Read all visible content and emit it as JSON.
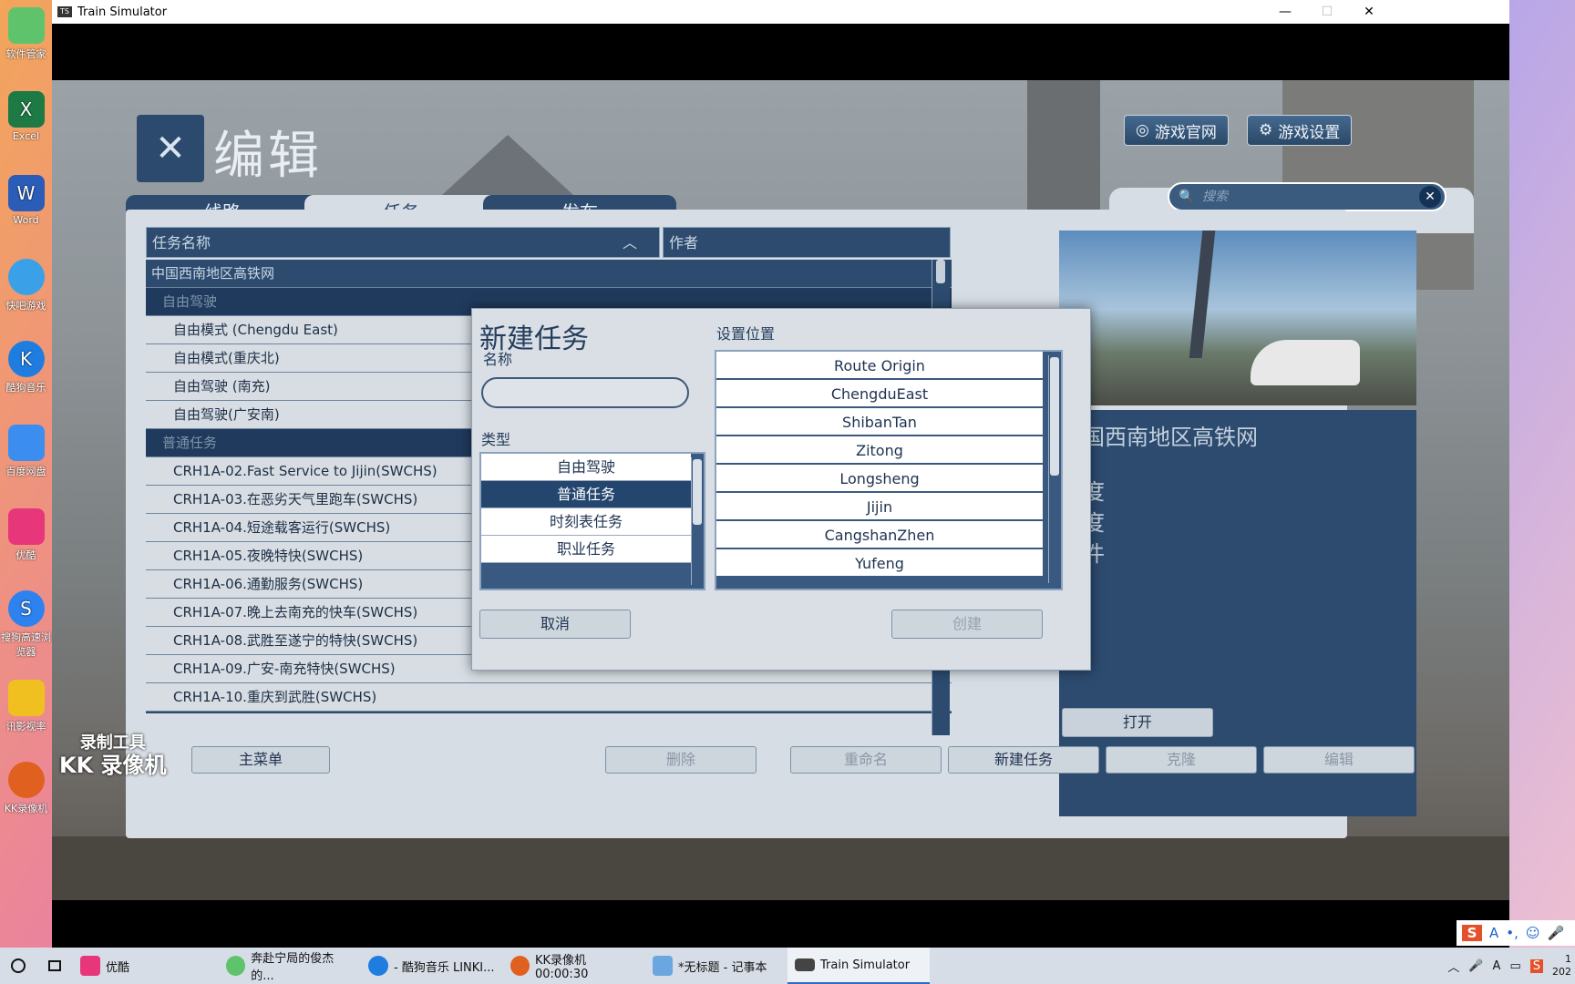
{
  "desktop": {
    "icons": [
      {
        "label": "软件管家",
        "color": "#5ec36b"
      },
      {
        "label": "Excel",
        "color": "#1d7a45",
        "glyph": "X"
      },
      {
        "label": "Word",
        "color": "#2b5db8",
        "glyph": "W"
      },
      {
        "label": "快吧游戏",
        "color": "#3aa0e8"
      },
      {
        "label": "酷狗音乐",
        "color": "#1f7de0",
        "glyph": "K"
      },
      {
        "label": "百度网盘",
        "color": "#3b8ef0"
      },
      {
        "label": "优酷",
        "color": "#e8367a"
      },
      {
        "label": "搜狗高速浏览器",
        "color": "#2e82f0",
        "glyph": "S"
      },
      {
        "label": "讯影视率",
        "color": "#f0c020"
      },
      {
        "label": "KK录像机",
        "color": "#e06020"
      }
    ]
  },
  "window": {
    "title": "Train Simulator",
    "icon_text": "TS",
    "controls": {
      "minimize": "—",
      "maximize": "☐",
      "close": "✕"
    }
  },
  "app": {
    "page_title": "编辑",
    "logo_icon": "tools-icon",
    "top_buttons": {
      "website": "游戏官网",
      "settings": "游戏设置"
    },
    "tabs": [
      {
        "label": "线路",
        "active": false
      },
      {
        "label": "任务",
        "active": true
      },
      {
        "label": "发布",
        "active": false
      }
    ],
    "search": {
      "placeholder": "搜索",
      "clear": "✕",
      "icon": "🔍"
    },
    "columns": {
      "name": "任务名称",
      "sort_icon": "︿",
      "author": "作者"
    },
    "list": [
      {
        "text": "中国西南地区高铁网",
        "kind": "grp"
      },
      {
        "text": "自由驾驶",
        "kind": "sub"
      },
      {
        "text": "自由模式 (Chengdu East)",
        "kind": "item"
      },
      {
        "text": "自由模式(重庆北)",
        "kind": "item"
      },
      {
        "text": "自由驾驶 (南充)",
        "kind": "item"
      },
      {
        "text": "自由驾驶(广安南)",
        "kind": "item"
      },
      {
        "text": "普通任务",
        "kind": "sub"
      },
      {
        "text": "CRH1A-02.Fast Service to Jijin(SWCHS)",
        "kind": "item"
      },
      {
        "text": "CRH1A-03.在恶劣天气里跑车(SWCHS)",
        "kind": "item"
      },
      {
        "text": "CRH1A-04.短途载客运行(SWCHS)",
        "kind": "item"
      },
      {
        "text": "CRH1A-05.夜晚特快(SWCHS)",
        "kind": "item"
      },
      {
        "text": "CRH1A-06.通勤服务(SWCHS)",
        "kind": "item"
      },
      {
        "text": "CRH1A-07.晚上去南充的快车(SWCHS)",
        "kind": "item"
      },
      {
        "text": "CRH1A-08.武胜至遂宁的特快(SWCHS)",
        "kind": "item"
      },
      {
        "text": "CRH1A-09.广安-南充特快(SWCHS)",
        "kind": "item"
      },
      {
        "text": "CRH1A-10.重庆到武胜(SWCHS)",
        "kind": "item"
      }
    ],
    "detail": {
      "title": "国西南地区高铁网",
      "lines": [
        "度",
        "度",
        "件"
      ],
      "open_button": "打开"
    },
    "bottom_buttons": {
      "main_menu": "主菜单",
      "delete": "删除",
      "rename": "重命名",
      "new_task": "新建任务",
      "clone": "克隆",
      "edit": "编辑"
    }
  },
  "dialog": {
    "title": "新建任务",
    "name_label": "名称",
    "name_value": "",
    "type_label": "类型",
    "types": [
      "自由驾驶",
      "普通任务",
      "时刻表任务",
      "职业任务"
    ],
    "selected_type": "普通任务",
    "location_label": "设置位置",
    "locations": [
      "Route Origin",
      "ChengduEast",
      "ShibanTan",
      "Zitong",
      "Longsheng",
      "Jijin",
      "CangshanZhen",
      "Yufeng"
    ],
    "cancel": "取消",
    "create": "创建"
  },
  "watermark": {
    "line1": "录制工具",
    "line2": "KK 录像机"
  },
  "taskbar": {
    "items": [
      {
        "label": "优酷",
        "color": "#e8367a"
      },
      {
        "label": "奔赴宁局的俊杰的...",
        "color": "#5ec36b"
      },
      {
        "label": "- 酷狗音乐 LINKI...",
        "color": "#1f7de0"
      },
      {
        "label": "KK录像机 00:00:30",
        "color": "#e06020"
      },
      {
        "label": "*无标题 - 记事本",
        "color": "#6aa6e0"
      },
      {
        "label": "Train Simulator",
        "color": "#444444",
        "active": true
      }
    ],
    "tray_lang": "A",
    "time_top": "1",
    "time_bottom": "202"
  },
  "ime": {
    "brand": "S",
    "mode": "A"
  }
}
